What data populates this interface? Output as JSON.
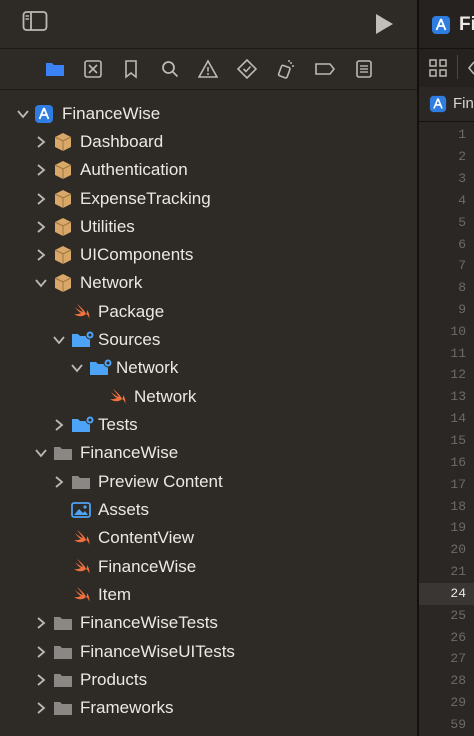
{
  "toolbar": {
    "sidebar_toggle_icon": "sidebar-toggle-icon",
    "run_icon": "play-icon"
  },
  "navigator_tabs": [
    {
      "icon": "folder-icon",
      "active": true
    },
    {
      "icon": "source-control-icon",
      "active": false
    },
    {
      "icon": "bookmark-icon",
      "active": false
    },
    {
      "icon": "search-icon",
      "active": false
    },
    {
      "icon": "warning-icon",
      "active": false
    },
    {
      "icon": "test-diamond-icon",
      "active": false
    },
    {
      "icon": "debug-spray-icon",
      "active": false
    },
    {
      "icon": "breakpoint-icon",
      "active": false
    },
    {
      "icon": "report-icon",
      "active": false
    }
  ],
  "tree": {
    "root": "FinanceWise",
    "items": [
      {
        "label": "Dashboard",
        "icon": "package-icon"
      },
      {
        "label": "Authentication",
        "icon": "package-icon"
      },
      {
        "label": "ExpenseTracking",
        "icon": "package-icon"
      },
      {
        "label": "Utilities",
        "icon": "package-icon"
      },
      {
        "label": "UIComponents",
        "icon": "package-icon"
      },
      {
        "label": "Network",
        "icon": "package-icon"
      },
      {
        "label": "Package",
        "icon": "swift-icon"
      },
      {
        "label": "Sources",
        "icon": "folder-gear-icon"
      },
      {
        "label": "Network",
        "icon": "folder-gear-icon"
      },
      {
        "label": "Network",
        "icon": "swift-icon"
      },
      {
        "label": "Tests",
        "icon": "folder-gear-icon"
      },
      {
        "label": "FinanceWise",
        "icon": "folder-icon"
      },
      {
        "label": "Preview Content",
        "icon": "folder-icon"
      },
      {
        "label": "Assets",
        "icon": "assets-icon"
      },
      {
        "label": "ContentView",
        "icon": "swift-icon"
      },
      {
        "label": "FinanceWise",
        "icon": "swift-icon"
      },
      {
        "label": "Item",
        "icon": "swift-icon"
      },
      {
        "label": "FinanceWiseTests",
        "icon": "folder-icon"
      },
      {
        "label": "FinanceWiseUITests",
        "icon": "folder-icon"
      },
      {
        "label": "Products",
        "icon": "folder-icon"
      },
      {
        "label": "Frameworks",
        "icon": "folder-icon"
      }
    ]
  },
  "editor": {
    "tab_title": "Fi",
    "breadcrumb": "Fin",
    "line_numbers": [
      "1",
      "2",
      "3",
      "4",
      "5",
      "6",
      "7",
      "8",
      "9",
      "10",
      "11",
      "12",
      "13",
      "14",
      "15",
      "16",
      "17",
      "18",
      "19",
      "20",
      "21",
      "24",
      "25",
      "26",
      "27",
      "28",
      "29",
      "59"
    ],
    "current_line": "24"
  },
  "colors": {
    "accent": "#3b82f6",
    "package": "#d9a868",
    "swift": "#f0713f",
    "folder_blue": "#4da3f5",
    "folder_gray": "#8a8784"
  }
}
